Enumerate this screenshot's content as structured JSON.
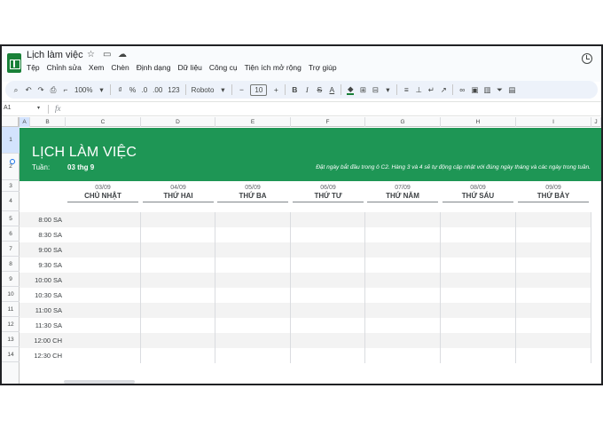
{
  "app": {
    "title": "Lịch làm việc",
    "menu": [
      "Tệp",
      "Chỉnh sửa",
      "Xem",
      "Chèn",
      "Định dạng",
      "Dữ liệu",
      "Công cụ",
      "Tiện ích mở rộng",
      "Trợ giúp"
    ],
    "title_icons": [
      "star-icon",
      "move-to-folder-icon",
      "cloud-status-icon"
    ],
    "history_icon": "history-icon"
  },
  "toolbar": {
    "zoom": "100%",
    "currency": "₫",
    "percent": "%",
    "decrease_decimal": ".0",
    "increase_decimal": ".00",
    "number_format": "123",
    "font": "Roboto",
    "font_size": "10",
    "minus": "−",
    "plus": "+",
    "bold": "B",
    "italic": "I",
    "strike": "S",
    "text_color": "A",
    "icons": [
      "search-icon",
      "undo-icon",
      "redo-icon",
      "print-icon",
      "paint-format-icon"
    ]
  },
  "formula_bar": {
    "cell_ref": "A1",
    "fx": "fx"
  },
  "columns": [
    "A",
    "B",
    "C",
    "D",
    "E",
    "F",
    "G",
    "H",
    "I",
    "J"
  ],
  "rows": [
    "1",
    "2",
    "3",
    "4",
    "5",
    "6",
    "7",
    "8",
    "9",
    "10",
    "11",
    "12",
    "13",
    "14"
  ],
  "banner": {
    "title": "LỊCH LÀM VIỆC",
    "week_label": "Tuần:",
    "week_date": "03 thg 9",
    "note": "Đặt ngày bắt đầu trong ô C2. Hàng 3 và 4 sẽ tự động cập nhật với đúng ngày tháng và các ngày trong tuần.",
    "color": "#1e9655"
  },
  "days": [
    {
      "date": "03/09",
      "name": "CHỦ NHẬT"
    },
    {
      "date": "04/09",
      "name": "THỨ HAI"
    },
    {
      "date": "05/09",
      "name": "THỨ BA"
    },
    {
      "date": "06/09",
      "name": "THỨ TƯ"
    },
    {
      "date": "07/09",
      "name": "THỨ NĂM"
    },
    {
      "date": "08/09",
      "name": "THỨ SÁU"
    },
    {
      "date": "09/09",
      "name": "THỨ BẢY"
    }
  ],
  "times": [
    "8:00 SA",
    "8:30 SA",
    "9:00 SA",
    "9:30 SA",
    "10:00 SA",
    "10:30 SA",
    "11:00 SA",
    "11:30 SA",
    "12:00 CH",
    "12:30 CH"
  ]
}
